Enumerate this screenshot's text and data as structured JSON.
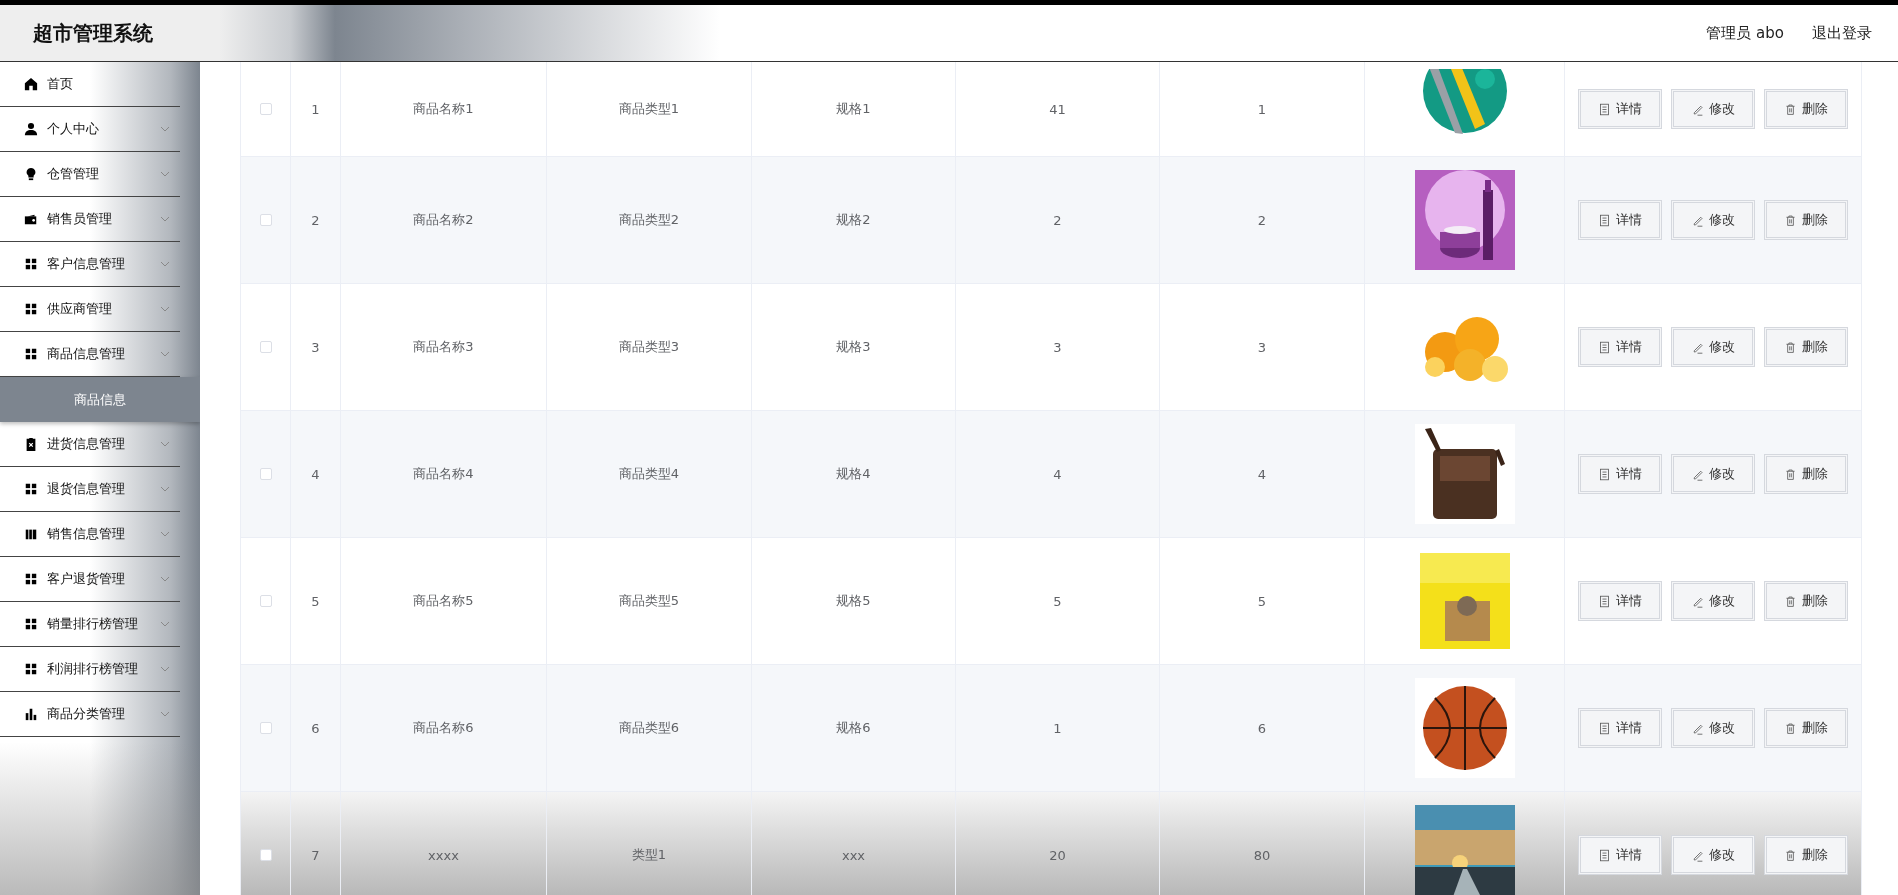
{
  "header": {
    "title": "超市管理系统",
    "user": "管理员 abo",
    "logout": "退出登录"
  },
  "sidebar": {
    "items": [
      {
        "label": "首页",
        "expandable": false
      },
      {
        "label": "个人中心",
        "expandable": true
      },
      {
        "label": "仓管管理",
        "expandable": true
      },
      {
        "label": "销售员管理",
        "expandable": true
      },
      {
        "label": "客户信息管理",
        "expandable": true
      },
      {
        "label": "供应商管理",
        "expandable": true
      },
      {
        "label": "商品信息管理",
        "expandable": true,
        "children": [
          {
            "label": "商品信息",
            "selected": true
          }
        ]
      },
      {
        "label": "进货信息管理",
        "expandable": true
      },
      {
        "label": "退货信息管理",
        "expandable": true
      },
      {
        "label": "销售信息管理",
        "expandable": true
      },
      {
        "label": "客户退货管理",
        "expandable": true
      },
      {
        "label": "销量排行榜管理",
        "expandable": true
      },
      {
        "label": "利润排行榜管理",
        "expandable": true
      },
      {
        "label": "商品分类管理",
        "expandable": true
      }
    ]
  },
  "table": {
    "rows": [
      {
        "checked": false,
        "cells": [
          "1",
          "商品名称1",
          "商品类型1",
          "规格1",
          "41",
          "1"
        ],
        "image": {
          "kind": "picture"
        },
        "actions": [
          "详情",
          "修改",
          "删除"
        ]
      },
      {
        "checked": false,
        "cells": [
          "2",
          "商品名称2",
          "商品类型2",
          "规格2",
          "2",
          "2"
        ],
        "image": {
          "kind": "picture"
        },
        "actions": [
          "详情",
          "修改",
          "删除"
        ]
      },
      {
        "checked": false,
        "cells": [
          "3",
          "商品名称3",
          "商品类型3",
          "规格3",
          "3",
          "3"
        ],
        "image": {
          "kind": "picture"
        },
        "actions": [
          "详情",
          "修改",
          "删除"
        ]
      },
      {
        "checked": false,
        "cells": [
          "4",
          "商品名称4",
          "商品类型4",
          "规格4",
          "4",
          "4"
        ],
        "image": {
          "kind": "picture"
        },
        "actions": [
          "详情",
          "修改",
          "删除"
        ]
      },
      {
        "checked": false,
        "cells": [
          "5",
          "商品名称5",
          "商品类型5",
          "规格5",
          "5",
          "5"
        ],
        "image": {
          "kind": "picture"
        },
        "actions": [
          "详情",
          "修改",
          "删除"
        ]
      },
      {
        "checked": false,
        "cells": [
          "6",
          "商品名称6",
          "商品类型6",
          "规格6",
          "1",
          "6"
        ],
        "image": {
          "kind": "picture"
        },
        "actions": [
          "详情",
          "修改",
          "删除"
        ]
      },
      {
        "checked": false,
        "cells": [
          "7",
          "xxxx",
          "类型1",
          "xxx",
          "20",
          "80"
        ],
        "image": {
          "kind": "picture"
        },
        "actions": [
          "详情",
          "修改",
          "删除"
        ]
      }
    ]
  }
}
